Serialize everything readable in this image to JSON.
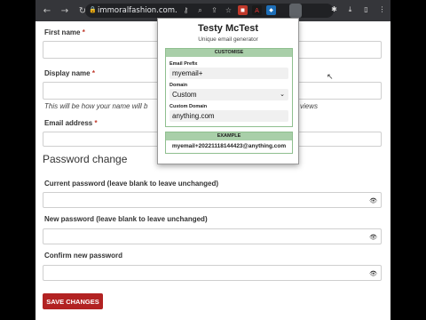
{
  "browser": {
    "url": "immoralfashion.com.au...",
    "icons": [
      "back-arrow-icon",
      "forward-arrow-icon",
      "reload-icon",
      "lock-icon",
      "key-icon",
      "zoom-icon",
      "share-icon",
      "star-icon",
      "extensions-icon",
      "download-icon",
      "sidebar-icon",
      "menu-icon"
    ]
  },
  "form": {
    "first_name_label": "First name",
    "display_name_label": "Display name",
    "display_name_hint": "This will be how your name will b",
    "display_name_hint_end": "views",
    "email_label": "Email address",
    "required_mark": "*",
    "password_section_title": "Password change",
    "current_password_label": "Current password (leave blank to leave unchanged)",
    "new_password_label": "New password (leave blank to leave unchanged)",
    "confirm_password_label": "Confirm new password",
    "save_button": "SAVE CHANGES"
  },
  "popup": {
    "title": "Testy McTest",
    "subtitle": "Unique email generator",
    "customise_header": "CUSTOMISE",
    "email_prefix_label": "Email Prefix",
    "email_prefix_value": "myemail+",
    "domain_label": "Domain",
    "domain_value": "Custom",
    "custom_domain_label": "Custom Domain",
    "custom_domain_value": "anything.com",
    "example_header": "EXAMPLE",
    "example_value": "myemail+20221118144423@anything.com"
  },
  "colors": {
    "brand_button": "#b22222",
    "panel_header": "#a9cfa9",
    "required": "#c0392b"
  }
}
